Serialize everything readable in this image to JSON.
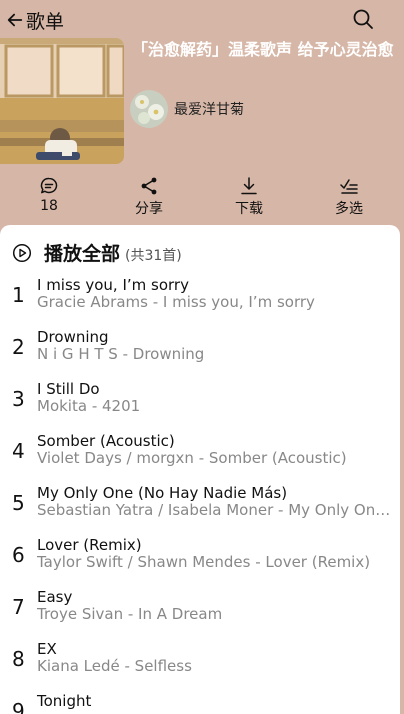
{
  "header": {
    "back_label": "歌单"
  },
  "playlist": {
    "title": "「治愈解药」温柔歌声 给予心灵治愈",
    "owner": "最爱洋甘菊"
  },
  "actions": [
    {
      "label": "18",
      "icon": "comment-icon"
    },
    {
      "label": "分享",
      "icon": "share-icon"
    },
    {
      "label": "下载",
      "icon": "download-icon"
    },
    {
      "label": "多选",
      "icon": "multi-select-icon"
    }
  ],
  "play_all": {
    "label": "播放全部",
    "count": "(共31首)"
  },
  "songs": [
    {
      "num": "1",
      "title": "I miss you, I’m sorry",
      "subtitle": "Gracie Abrams - I miss you, I’m sorry"
    },
    {
      "num": "2",
      "title": "Drowning",
      "subtitle": "N i G H T S - Drowning"
    },
    {
      "num": "3",
      "title": "I Still Do",
      "subtitle": "Mokita - 4201"
    },
    {
      "num": "4",
      "title": "Somber (Acoustic)",
      "subtitle": "Violet Days / morgxn - Somber (Acoustic)"
    },
    {
      "num": "5",
      "title": "My Only One (No Hay Nadie Más)",
      "subtitle": "Sebastian Yatra / Isabela Moner - My Only One (No Hay Nadie Más)"
    },
    {
      "num": "6",
      "title": "Lover (Remix)",
      "subtitle": "Taylor Swift / Shawn Mendes - Lover (Remix)"
    },
    {
      "num": "7",
      "title": "Easy",
      "subtitle": "Troye Sivan - In A Dream"
    },
    {
      "num": "8",
      "title": "EX",
      "subtitle": "Kiana Ledé - Selfless"
    },
    {
      "num": "9",
      "title": "Tonight",
      "subtitle": ""
    }
  ]
}
